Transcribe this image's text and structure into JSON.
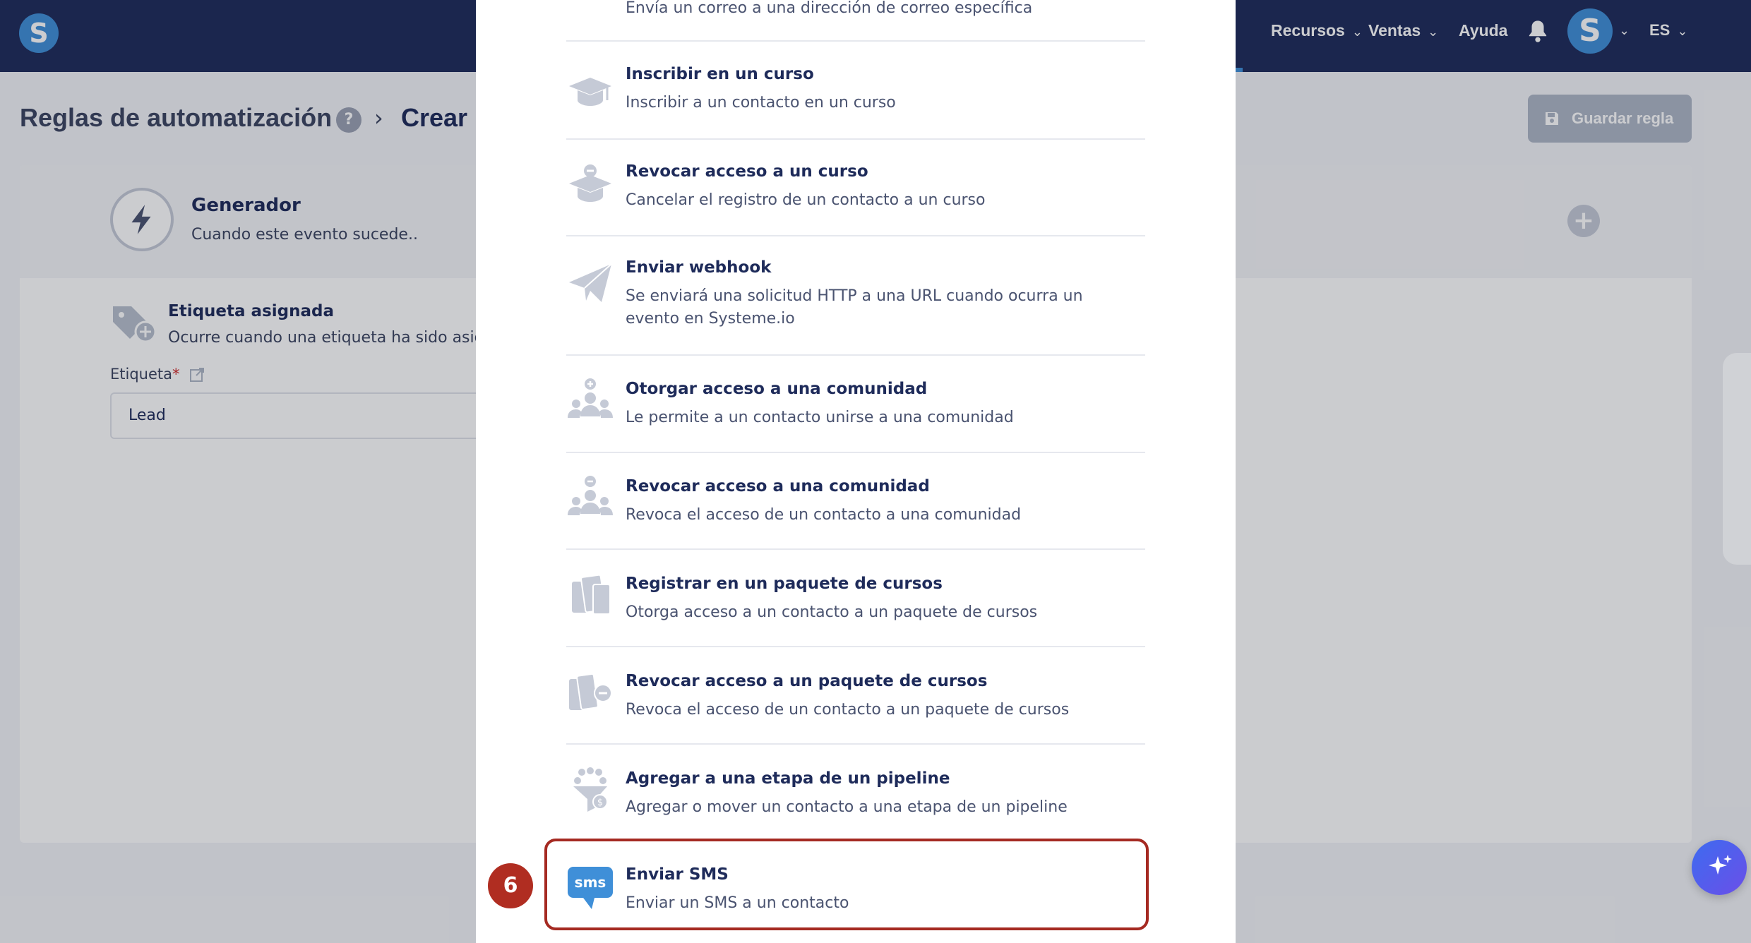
{
  "nav": {
    "items": [
      "Recursos",
      "Ventas",
      "Ayuda"
    ],
    "lang": "ES",
    "logo_letter": "S",
    "avatar_letter": "S"
  },
  "page": {
    "breadcrumb_root": "Reglas de automatización",
    "breadcrumb_current": "Crear r",
    "save_label": "Guardar regla"
  },
  "trigger": {
    "title": "Generador",
    "subtitle": "Cuando este evento sucede..",
    "event_title": "Etiqueta asignada",
    "event_subtitle": "Ocurre cuando una etiqueta ha sido asign",
    "field_label": "Etiqueta",
    "field_value": "Lead"
  },
  "actions": [
    {
      "title": "",
      "desc": "Envía un correo a una dirección de correo específica",
      "icon": "mail-icon"
    },
    {
      "title": "Inscribir en un curso",
      "desc": "Inscribir a un contacto en un curso",
      "icon": "graduation-cap-icon"
    },
    {
      "title": "Revocar acceso a un curso",
      "desc": "Cancelar el registro de un contacto a un curso",
      "icon": "graduation-cap-remove-icon"
    },
    {
      "title": "Enviar webhook",
      "desc": "Se enviará una solicitud HTTP a una URL cuando ocurra un evento en Systeme.io",
      "icon": "paper-plane-icon"
    },
    {
      "title": "Otorgar acceso a una comunidad",
      "desc": "Le permite a un contacto unirse a una comunidad",
      "icon": "community-add-icon"
    },
    {
      "title": "Revocar acceso a una comunidad",
      "desc": "Revoca el acceso de un contacto a una comunidad",
      "icon": "community-remove-icon"
    },
    {
      "title": "Registrar en un paquete de cursos",
      "desc": "Otorga acceso a un contacto a un paquete de cursos",
      "icon": "course-bundle-icon"
    },
    {
      "title": "Revocar acceso a un paquete de cursos",
      "desc": "Revoca el acceso de un contacto a un paquete de cursos",
      "icon": "course-bundle-remove-icon"
    },
    {
      "title": "Agregar a una etapa de un pipeline",
      "desc": "Agregar o mover un contacto a una etapa de un pipeline",
      "icon": "pipeline-icon"
    },
    {
      "title": "Enviar SMS",
      "desc": "Enviar un SMS a un contacto",
      "icon": "sms-icon",
      "icon_text": "sms"
    }
  ],
  "step_badge": "6",
  "colors": {
    "nav_bg": "#1e2b5a",
    "brand_blue": "#3f8fd8",
    "highlight_red": "#a52a22",
    "icon_grey": "#c5cad6"
  }
}
